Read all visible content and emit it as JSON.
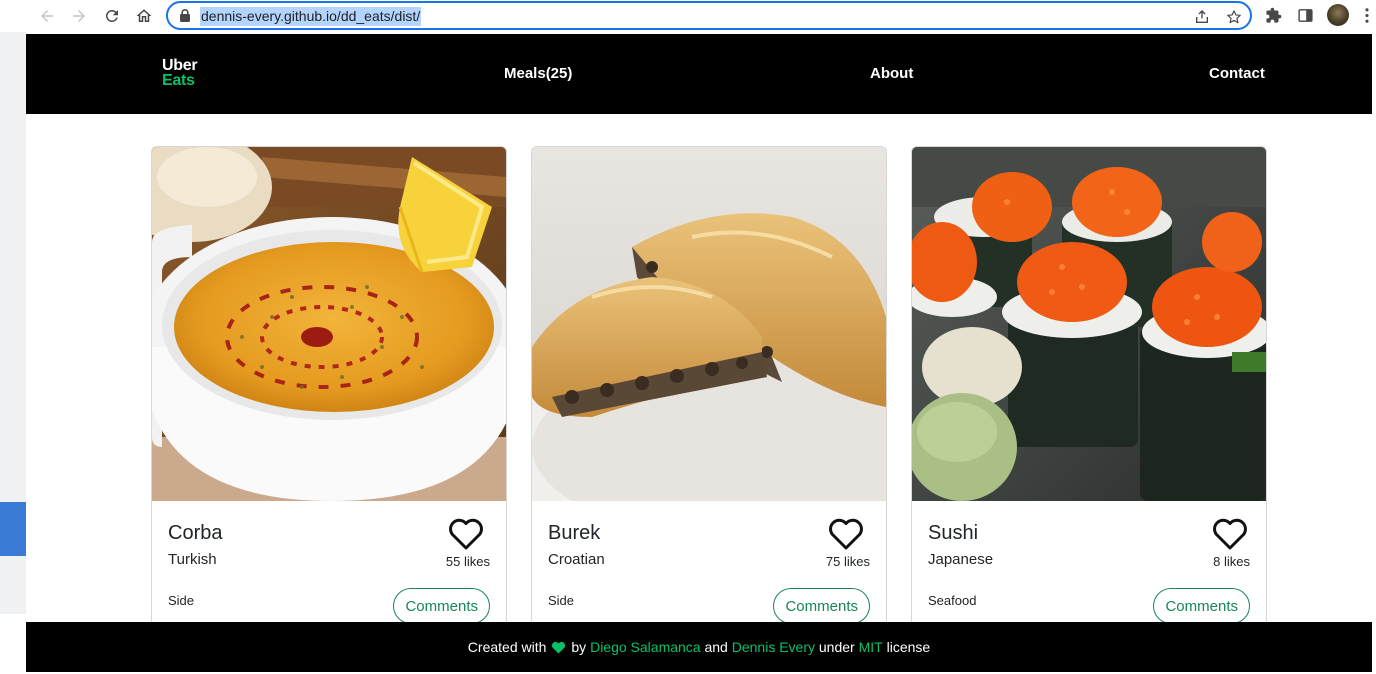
{
  "browser": {
    "url": "dennis-every.github.io/dd_eats/dist/"
  },
  "site": {
    "logo_top": "Uber",
    "logo_bottom": "Eats",
    "nav": {
      "meals": "Meals(25)",
      "about": "About",
      "contact": "Contact"
    }
  },
  "meals": [
    {
      "title": "Corba",
      "origin": "Turkish",
      "category": "Side",
      "likes": "55 likes",
      "comments_label": "Comments"
    },
    {
      "title": "Burek",
      "origin": "Croatian",
      "category": "Side",
      "likes": "75 likes",
      "comments_label": "Comments"
    },
    {
      "title": "Sushi",
      "origin": "Japanese",
      "category": "Seafood",
      "likes": "8 likes",
      "comments_label": "Comments"
    }
  ],
  "footer": {
    "created_with": "Created with",
    "by": "by",
    "author1": "Diego Salamanca",
    "and": "and",
    "author2": "Dennis Every",
    "under": "under",
    "license_link": "MIT",
    "license": "license"
  },
  "colors": {
    "header_bg": "#000000",
    "accent_green": "#06c167",
    "button_green": "#198754",
    "omnibox_border": "#1a73e8"
  },
  "icons": [
    "back-arrow-icon",
    "forward-arrow-icon",
    "reload-icon",
    "home-icon",
    "lock-icon",
    "share-icon",
    "star-icon",
    "extensions-icon",
    "side-panel-icon",
    "menu-dots-icon",
    "heart-outline-icon",
    "heart-filled-icon"
  ]
}
